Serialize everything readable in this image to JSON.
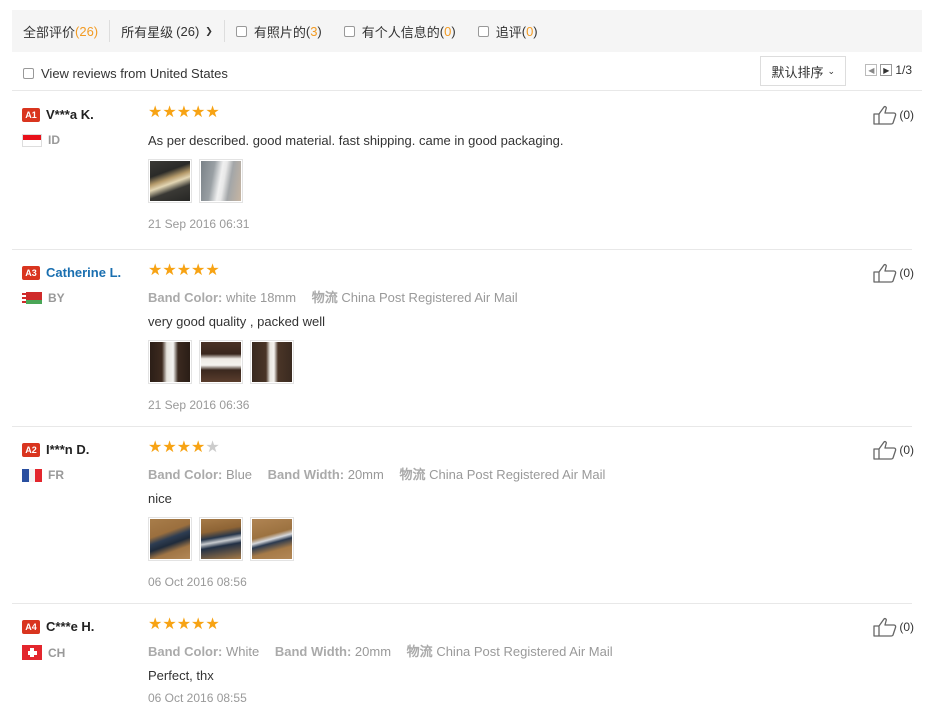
{
  "filters": {
    "all_label": "全部评价",
    "all_count": "(26)",
    "stars_label": "所有星级",
    "stars_count": "(26)",
    "photos_label": "有照片的",
    "photos_open": "(",
    "photos_count": "3",
    "photos_close": ")",
    "personal_label": "有个人信息的",
    "personal_open": "(",
    "personal_count": "0",
    "personal_close": ")",
    "followup_label": "追评",
    "followup_open": "(",
    "followup_count": "0",
    "followup_close": ")"
  },
  "toolbar": {
    "country_filter_label": "View reviews from United States",
    "sort_label": "默认排序",
    "page_indicator": "1/3"
  },
  "reviews": [
    {
      "badge": "A1",
      "name": "V***a K.",
      "country": "ID",
      "rating": 5,
      "stars": "★★★★★",
      "stars_off": "",
      "text": "As per described. good material. fast shipping. came in good packaging.",
      "date": "21 Sep 2016 06:31",
      "likes": "(0)"
    },
    {
      "badge": "A3",
      "name": "Catherine L.",
      "country": "BY",
      "rating": 5,
      "stars": "★★★★★",
      "stars_off": "",
      "color_label": "Band Color:",
      "color_value": "white 18mm",
      "shipping_label": "物流",
      "shipping_value": "China Post Registered Air Mail",
      "text": "very good quality , packed well",
      "date": "21 Sep 2016 06:36",
      "likes": "(0)"
    },
    {
      "badge": "A2",
      "name": "I***n D.",
      "country": "FR",
      "rating": 4,
      "stars": "★★★★",
      "stars_off": "★",
      "color_label": "Band Color:",
      "color_value": "Blue",
      "width_label": "Band Width:",
      "width_value": "20mm",
      "shipping_label": "物流",
      "shipping_value": "China Post Registered Air Mail",
      "text": "nice",
      "date": "06 Oct 2016 08:56",
      "likes": "(0)"
    },
    {
      "badge": "A4",
      "name": "C***e H.",
      "country": "CH",
      "rating": 5,
      "stars": "★★★★★",
      "stars_off": "",
      "color_label": "Band Color:",
      "color_value": "White",
      "width_label": "Band Width:",
      "width_value": "20mm",
      "shipping_label": "物流",
      "shipping_value": "China Post Registered Air Mail",
      "text": "Perfect, thx",
      "date": "06 Oct 2016 08:55",
      "likes": "(0)"
    }
  ],
  "colors": {
    "star": "#f7a314",
    "badge": "#d9351f",
    "count": "#f29b24",
    "name_link": "#1a6fb0"
  }
}
